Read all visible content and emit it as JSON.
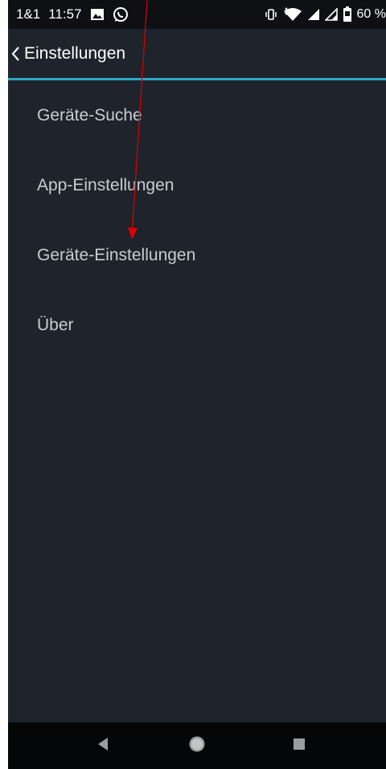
{
  "status_bar": {
    "carrier": "1&1",
    "time": "11:57",
    "battery": "60 %",
    "left_icons": [
      "image-icon",
      "whatsapp-icon"
    ],
    "right_icons": [
      "vibrate-icon",
      "wifi-icon",
      "signal-icon",
      "signal-icon",
      "battery-icon"
    ]
  },
  "toolbar": {
    "back_icon": "chevron-left-icon",
    "title": "Einstellungen"
  },
  "menu": {
    "items": [
      {
        "label": "Geräte-Suche"
      },
      {
        "label": "App-Einstellungen"
      },
      {
        "label": "Geräte-Einstellungen"
      },
      {
        "label": "Über"
      }
    ]
  },
  "nav_bar": {
    "icons": [
      "back-triangle-icon",
      "home-circle-icon",
      "recents-square-icon"
    ]
  },
  "colors": {
    "background": "#1f232b",
    "accent_divider": "#2aa7c9",
    "annotation_arrow": "#e00000",
    "menu_text": "#c9ccd2"
  }
}
